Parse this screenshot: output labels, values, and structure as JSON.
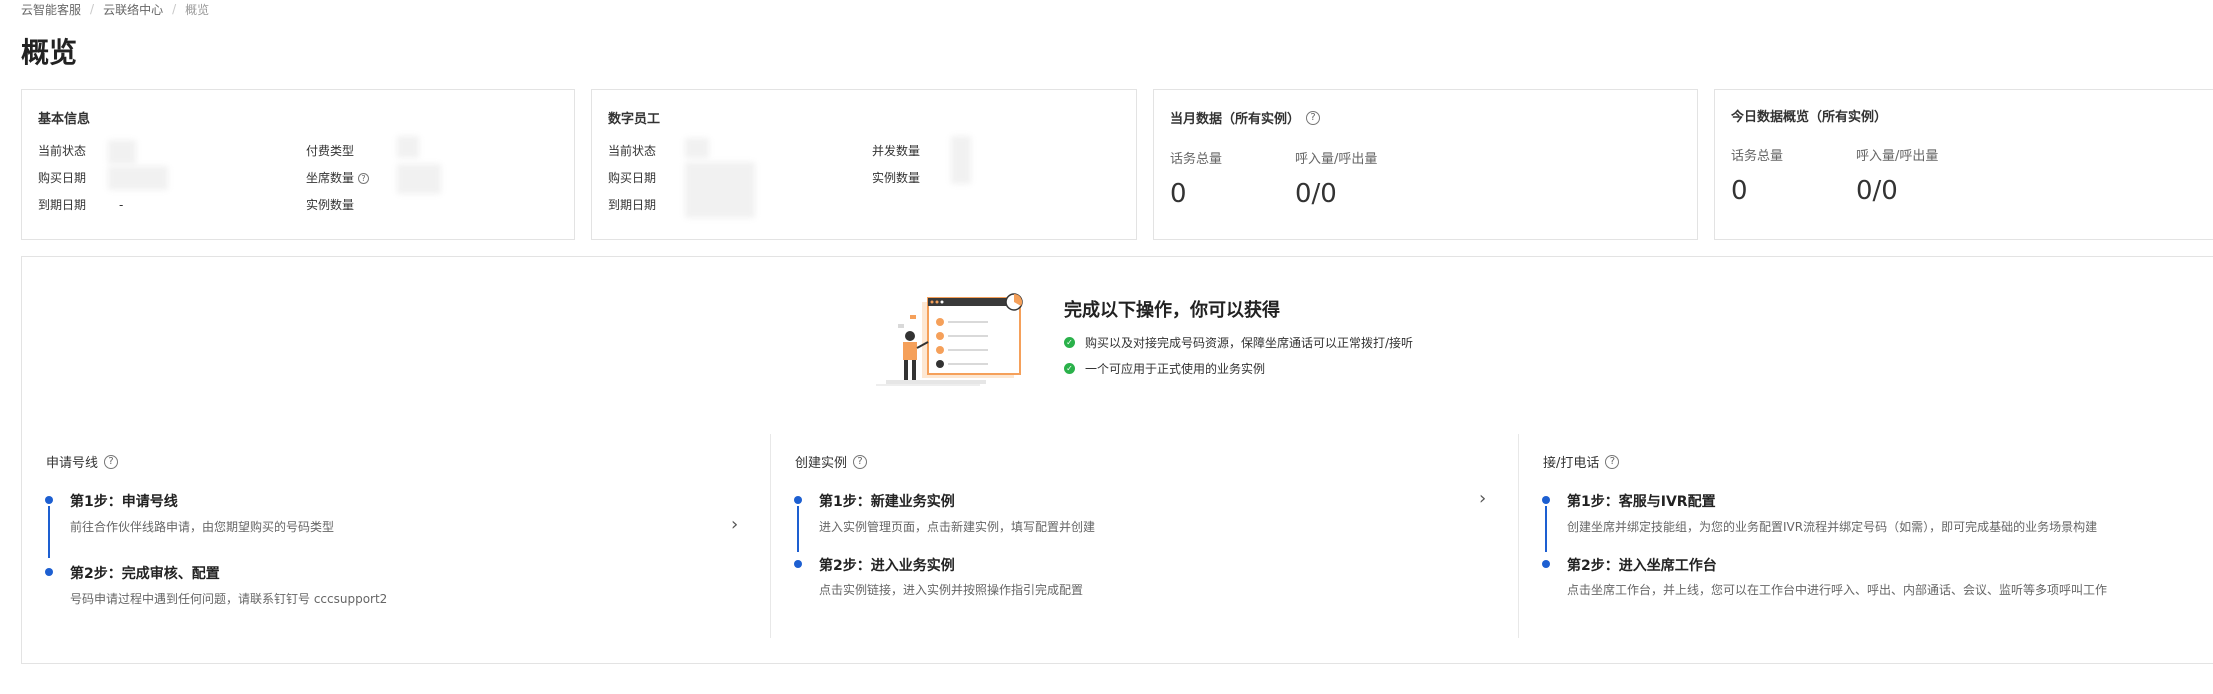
{
  "breadcrumb": [
    "云智能客服",
    "云联络中心",
    "概览"
  ],
  "page_title": "概览",
  "basic_info": {
    "title": "基本信息",
    "current_status": "当前状态",
    "purchase_date": "购买日期",
    "expire_date": "到期日期",
    "expire_value": "-",
    "pay_type": "付费类型",
    "seat_count": "坐席数量",
    "instance_count": "实例数量"
  },
  "digital_staff": {
    "title": "数字员工",
    "current_status": "当前状态",
    "purchase_date": "购买日期",
    "expire_date": "到期日期",
    "concurrency": "并发数量",
    "instance_count": "实例数量"
  },
  "month_data": {
    "title": "当月数据（所有实例）",
    "total_label": "话务总量",
    "inout_label": "呼入量/呼出量",
    "total_value": "0",
    "inout_value": "0/0"
  },
  "today_data": {
    "title": "今日数据概览（所有实例）",
    "total_label": "话务总量",
    "inout_label": "呼入量/呼出量",
    "total_value": "0",
    "inout_value": "0/0"
  },
  "promo": {
    "title": "完成以下操作，你可以获得",
    "items": [
      "购买以及对接完成号码资源，保障坐席通话可以正常拨打/接听",
      "一个可应用于正式使用的业务实例"
    ]
  },
  "sections": [
    {
      "title": "申请号线",
      "steps": [
        {
          "title": "第1步：申请号线",
          "desc": "前往合作伙伴线路申请，由您期望购买的号码类型"
        },
        {
          "title": "第2步：完成审核、配置",
          "desc": "号码申请过程中遇到任何问题，请联系钉钉号 cccsupport2"
        }
      ]
    },
    {
      "title": "创建实例",
      "steps": [
        {
          "title": "第1步：新建业务实例",
          "desc": "进入实例管理页面，点击新建实例，填写配置并创建"
        },
        {
          "title": "第2步：进入业务实例",
          "desc": "点击实例链接，进入实例并按照操作指引完成配置"
        }
      ]
    },
    {
      "title": "接/打电话",
      "steps": [
        {
          "title": "第1步：客服与IVR配置",
          "desc": "创建坐席并绑定技能组，为您的业务配置IVR流程并绑定号码（如需），即可完成基础的业务场景构建"
        },
        {
          "title": "第2步：进入坐席工作台",
          "desc": "点击坐席工作台，并上线，您可以在工作台中进行呼入、呼出、内部通话、会议、监听等多项呼叫工作"
        }
      ]
    }
  ],
  "icons": {
    "help": "question-circle-icon",
    "check": "check-circle-icon",
    "chevron": "chevron-right-icon"
  },
  "colors": {
    "accent": "#1d5fd1",
    "success": "#2ab14a",
    "illustration": "#f5a05a"
  }
}
